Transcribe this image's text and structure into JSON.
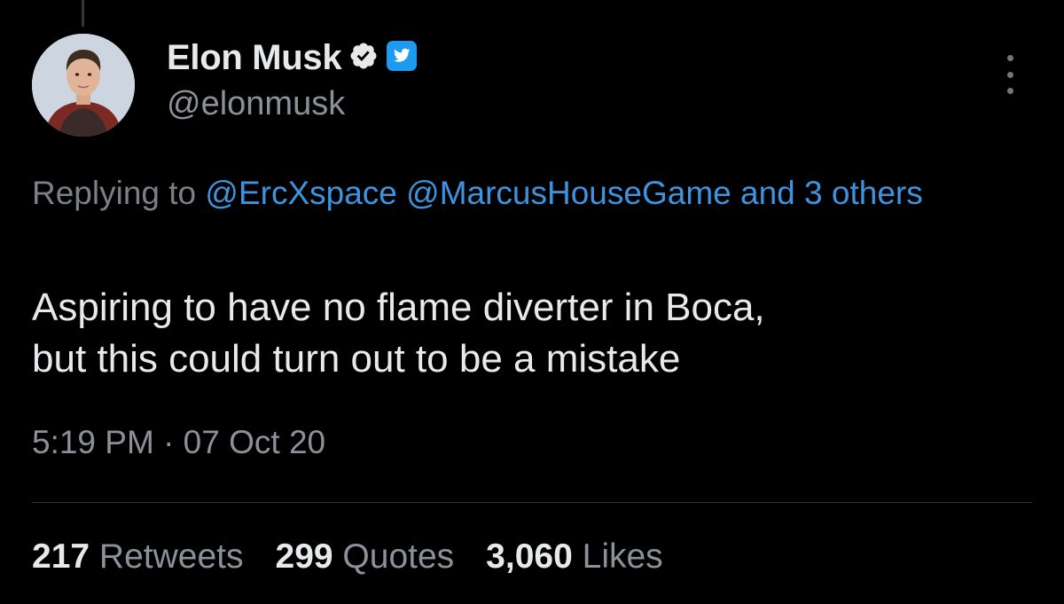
{
  "author": {
    "display_name": "Elon Musk",
    "handle": "@elonmusk",
    "verified": true,
    "badges": [
      "verified-badge-icon",
      "twitter-bird-icon"
    ]
  },
  "reply_context": {
    "prefix": "Replying to",
    "mentions": [
      "@ErcXspace",
      "@MarcusHouseGame"
    ],
    "suffix": "and 3 others"
  },
  "tweet": {
    "lines": [
      "Aspiring to have no flame diverter in Boca,",
      "but this could turn out to be a mistake"
    ],
    "timestamp": "5:19 PM · 07 Oct 20"
  },
  "stats": {
    "retweets": {
      "count": "217",
      "label": "Retweets"
    },
    "quotes": {
      "count": "299",
      "label": "Quotes"
    },
    "likes": {
      "count": "3,060",
      "label": "Likes"
    }
  },
  "colors": {
    "background": "#000000",
    "primary_text": "#e7e9ea",
    "secondary_text": "#8b9198",
    "link": "#3e93de",
    "verified_badge": "#1d9bf0"
  }
}
